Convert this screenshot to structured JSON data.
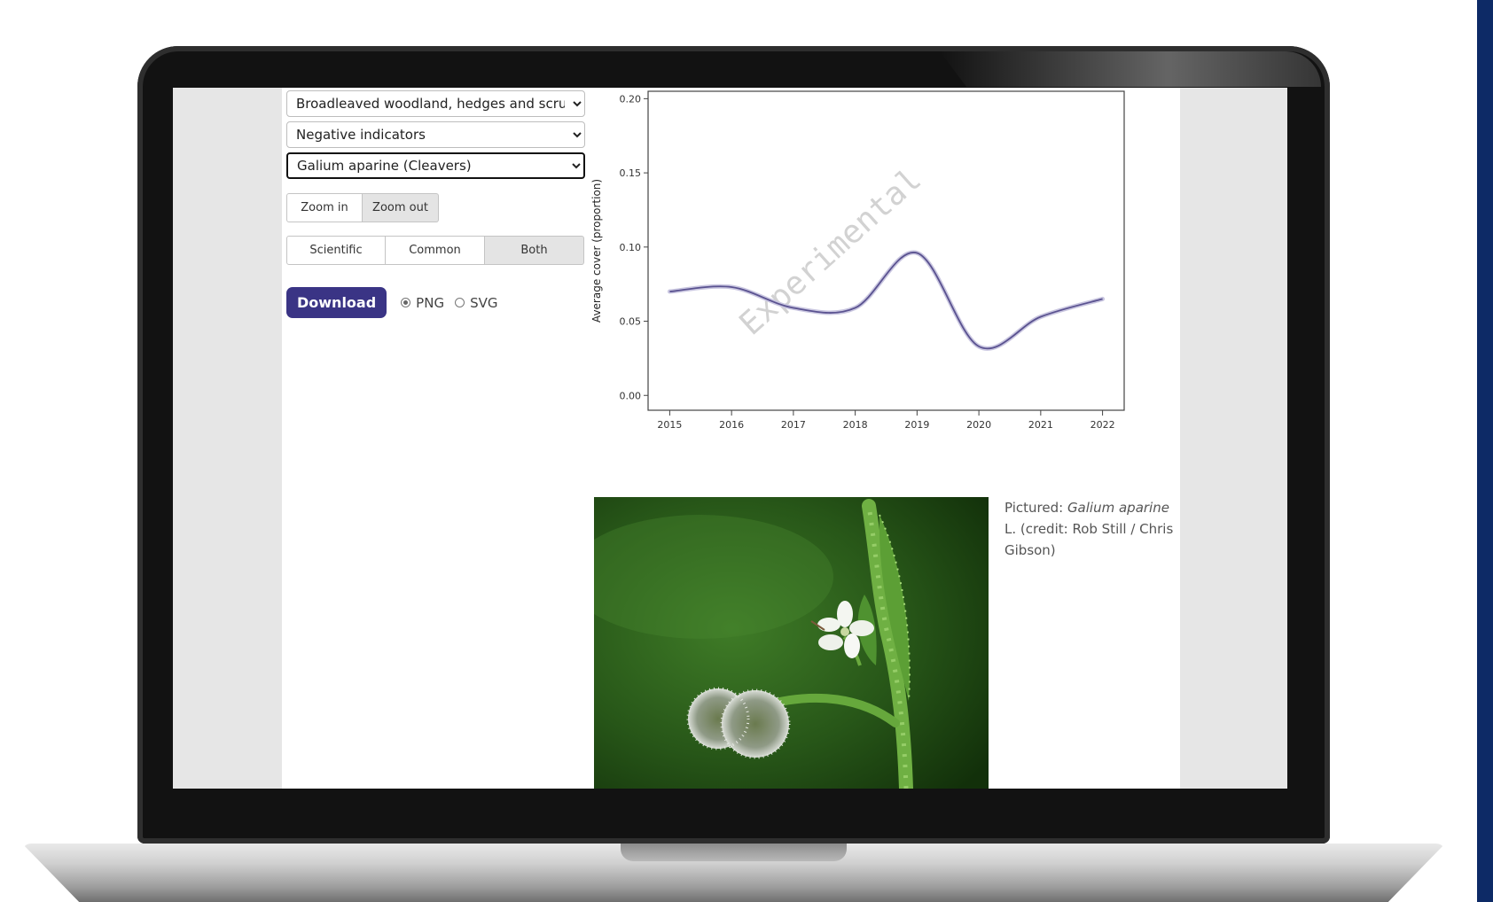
{
  "controls": {
    "habitat_select": "Broadleaved woodland, hedges and scrub",
    "indicator_select": "Negative indicators",
    "species_select": "Galium aparine (Cleavers)",
    "zoom_in_label": "Zoom in",
    "zoom_out_label": "Zoom out",
    "name_buttons": [
      "Scientific",
      "Common",
      "Both"
    ],
    "active_name_button": "Both",
    "download_label": "Download",
    "format_options": [
      "PNG",
      "SVG"
    ],
    "selected_format": "PNG"
  },
  "chart_data": {
    "type": "line",
    "ylabel": "Average cover (proportion)",
    "xlabel": "",
    "x": [
      2015,
      2016,
      2017,
      2018,
      2019,
      2020,
      2021,
      2022
    ],
    "series": [
      {
        "values": [
          0.07,
          0.073,
          0.059,
          0.059,
          0.096,
          0.033,
          0.053,
          0.065
        ]
      }
    ],
    "xlim": [
      2014.65,
      2022.35
    ],
    "ylim": [
      -0.01,
      0.205
    ],
    "yticks": [
      "0.00",
      "0.05",
      "0.10",
      "0.15",
      "0.20"
    ],
    "xticks": [
      "2015",
      "2016",
      "2017",
      "2018",
      "2019",
      "2020",
      "2021",
      "2022"
    ],
    "watermark": "Experimental",
    "line_color": "#5a5290",
    "grid": false
  },
  "caption": {
    "prefix": "Pictured: ",
    "species": "Galium aparine",
    "suffix": " L. (credit: Rob Still / Chris Gibson)"
  },
  "colors": {
    "accent": "#3a3485",
    "side_bar": "#0d2a66"
  }
}
